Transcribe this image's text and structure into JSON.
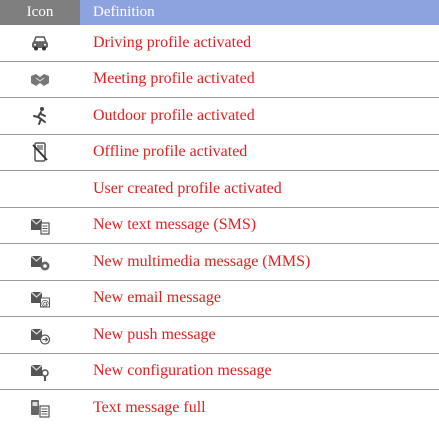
{
  "header": {
    "icon_label": "Icon",
    "definition_label": "Definition"
  },
  "rows": [
    {
      "icon": "car-icon",
      "definition": "Driving profile activated"
    },
    {
      "icon": "handshake-icon",
      "definition": "Meeting profile activated"
    },
    {
      "icon": "running-person-icon",
      "definition": "Outdoor profile activated"
    },
    {
      "icon": "phone-off-icon",
      "definition": "Offline profile activated"
    },
    {
      "icon": "",
      "definition": "User created profile activated"
    },
    {
      "icon": "sms-icon",
      "definition": "New text message (SMS)"
    },
    {
      "icon": "mms-icon",
      "definition": "New multimedia message (MMS)"
    },
    {
      "icon": "email-icon",
      "definition": "New email message"
    },
    {
      "icon": "push-message-icon",
      "definition": "New push message"
    },
    {
      "icon": "config-message-icon",
      "definition": "New configuration message"
    },
    {
      "icon": "message-full-icon",
      "definition": "Text message full"
    }
  ],
  "colors": {
    "header_icon_bg": "#7f7f7f",
    "header_def_bg": "#8da3df",
    "definition_text": "#e02020"
  }
}
